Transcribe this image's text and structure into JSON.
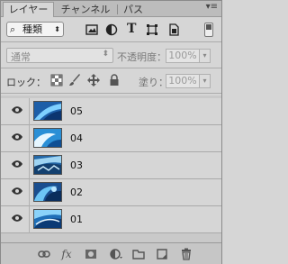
{
  "tabs": [
    {
      "label": "レイヤー",
      "active": true
    },
    {
      "label": "チャンネル",
      "active": false
    },
    {
      "label": "パス",
      "active": false
    }
  ],
  "panel_menu": "≡",
  "filter": {
    "kind_label": "種類",
    "icons": [
      "pixel-filter-icon",
      "adjustment-filter-icon",
      "type-filter-icon",
      "shape-filter-icon",
      "smart-object-filter-icon"
    ],
    "type_glyph": "T"
  },
  "blend_mode": "通常",
  "opacity": {
    "label": "不透明度：",
    "value": "100%"
  },
  "lock": {
    "label": "ロック："
  },
  "fill": {
    "label": "塗り：",
    "value": "100%"
  },
  "layers": [
    {
      "name": "05"
    },
    {
      "name": "04"
    },
    {
      "name": "03"
    },
    {
      "name": "02"
    },
    {
      "name": "01"
    }
  ],
  "bottom": {
    "fx_label": "fx"
  },
  "colors": {
    "panel_bg": "#d6d6d6",
    "tab_bar": "#bcbcbc",
    "thumb_blue": "#1d5ea8"
  }
}
